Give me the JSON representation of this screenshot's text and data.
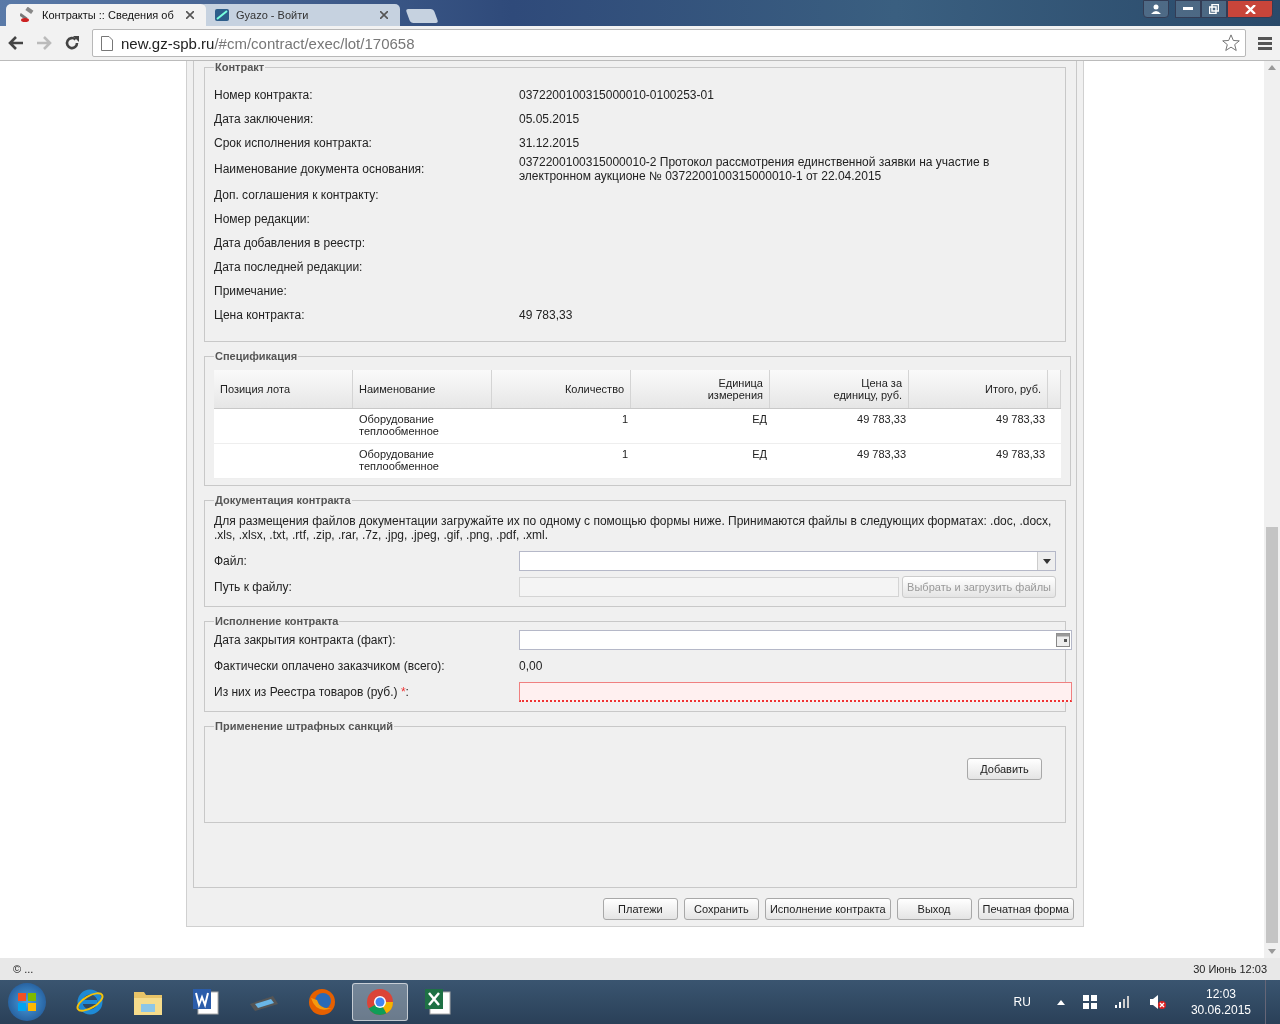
{
  "tabs": [
    {
      "title": "Контракты :: Сведения об",
      "selected": true,
      "kind": "gavel"
    },
    {
      "title": "Gyazo - Войти",
      "selected": false,
      "kind": "gyazo"
    }
  ],
  "address": {
    "host": "new.gz-spb.ru",
    "path": "/#cm/contract/exec/lot/170658"
  },
  "contract": {
    "legend": "Контракт",
    "fields": [
      {
        "label": "Номер контракта:",
        "value": "0372200100315000010-0100253-01"
      },
      {
        "label": "Дата заключения:",
        "value": "05.05.2015"
      },
      {
        "label": "Срок исполнения контракта:",
        "value": "31.12.2015"
      },
      {
        "label": "Наименование документа основания:",
        "value": "0372200100315000010-2 Протокол рассмотрения единственной заявки на участие в электронном аукционе № 0372200100315000010-1 от 22.04.2015"
      },
      {
        "label": "Доп. соглашения к контракту:"
      },
      {
        "label": "Номер редакции:"
      },
      {
        "label": "Дата добавления в реестр:"
      },
      {
        "label": "Дата последней редакции:"
      },
      {
        "label": "Примечание:"
      },
      {
        "label": "Цена контракта:",
        "value": "49 783,33"
      }
    ]
  },
  "spec": {
    "legend": "Спецификация",
    "columns": [
      "Позиция лота",
      "Наименование",
      "Количество",
      "Единица измерения",
      "Цена за единицу, руб.",
      "Итого, руб."
    ],
    "rows": [
      [
        "",
        "Оборудование теплообменное",
        "1",
        "ЕД",
        "49 783,33",
        "49 783,33"
      ],
      [
        "",
        "Оборудование теплообменное",
        "1",
        "ЕД",
        "49 783,33",
        "49 783,33"
      ]
    ]
  },
  "docs": {
    "legend": "Документация контракта",
    "note": "Для размещения файлов документации загружайте их по одному с помощью формы ниже. Принимаются файлы в следующих форматах: .doc, .docx, .xls, .xlsx, .txt, .rtf, .zip, .rar, .7z, .jpg, .jpeg, .gif, .png, .pdf, .xml.",
    "file_label": "Файл:",
    "path_label": "Путь к файлу:",
    "upload_button": {
      "label": "Выбрать и загрузить файлы",
      "disabled": true
    }
  },
  "execution": {
    "legend": "Исполнение контракта",
    "rows": [
      {
        "kind": "date",
        "label": "Дата закрытия контракта (факт):"
      },
      {
        "kind": "text",
        "label": "Фактически оплачено заказчиком (всего):",
        "value": "0,00"
      },
      {
        "kind": "required",
        "label": "Из них из Реестра товаров (руб.)",
        "mark": "*",
        "suffix": ":",
        "invalid": true
      }
    ]
  },
  "penalties": {
    "legend": "Применение штрафных санкций",
    "add_button": "Добавить"
  },
  "buttons": [
    "Платежи",
    "Сохранить",
    "Исполнение контракта",
    "Выход",
    "Печатная форма"
  ],
  "status_bar": {
    "left": "© ...",
    "right": "30 Июнь 12:03"
  },
  "taskbar": {
    "apps": [
      {
        "kind": "ie",
        "selected": false
      },
      {
        "kind": "folder",
        "selected": false
      },
      {
        "kind": "word",
        "selected": false
      },
      {
        "kind": "scanner",
        "selected": false
      },
      {
        "kind": "firefox",
        "selected": false
      },
      {
        "kind": "chrome",
        "selected": true
      },
      {
        "kind": "excel",
        "selected": false
      }
    ],
    "lang": "RU",
    "time": "12:03",
    "date": "30.06.2015"
  }
}
